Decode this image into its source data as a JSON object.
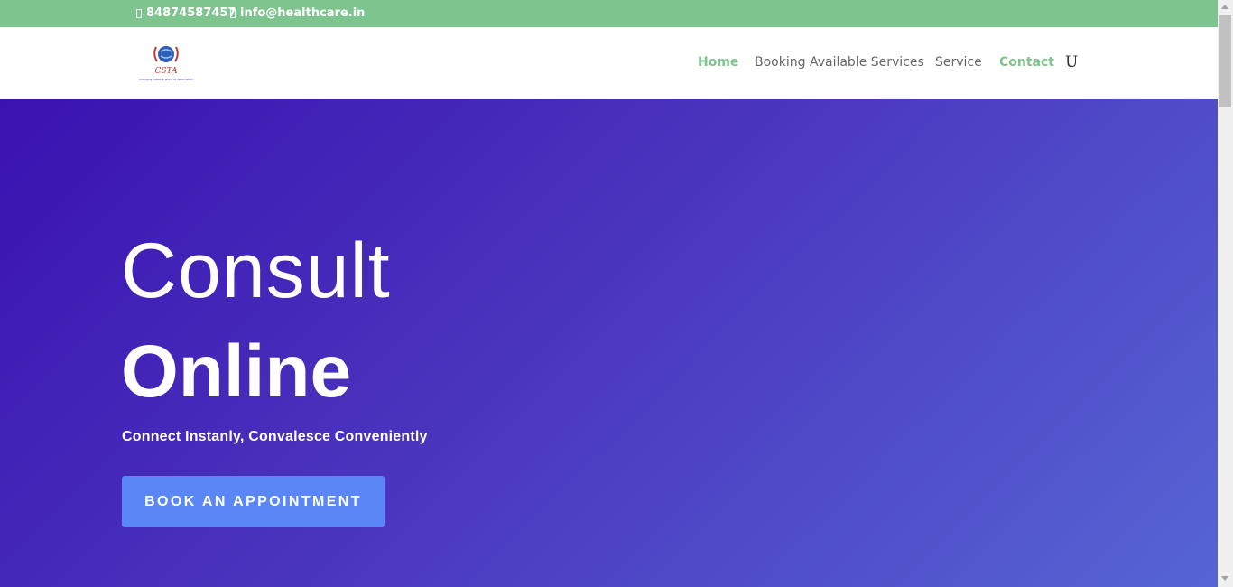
{
  "topbar": {
    "phone": "84874587457",
    "email": "info@healthcare.in"
  },
  "logo": {
    "letters": "CSTA",
    "tagline": "Changing Towards World Of Automation"
  },
  "nav": {
    "items": [
      {
        "label": "Home"
      },
      {
        "label": "Booking Available Services"
      },
      {
        "label": "Service"
      },
      {
        "label": "Contact"
      }
    ],
    "search_glyph": "U"
  },
  "hero": {
    "title_line1": "Consult",
    "title_line2": "Online",
    "subtitle": "Connect Instanly, Convalesce Conveniently",
    "cta_label": "BOOK AN APPOINTMENT"
  },
  "colors": {
    "topbar": "#7ec48e",
    "accent": "#7ec48e",
    "hero_start": "#3a12b0",
    "hero_end": "#5665d4",
    "cta": "#5b86f5"
  }
}
